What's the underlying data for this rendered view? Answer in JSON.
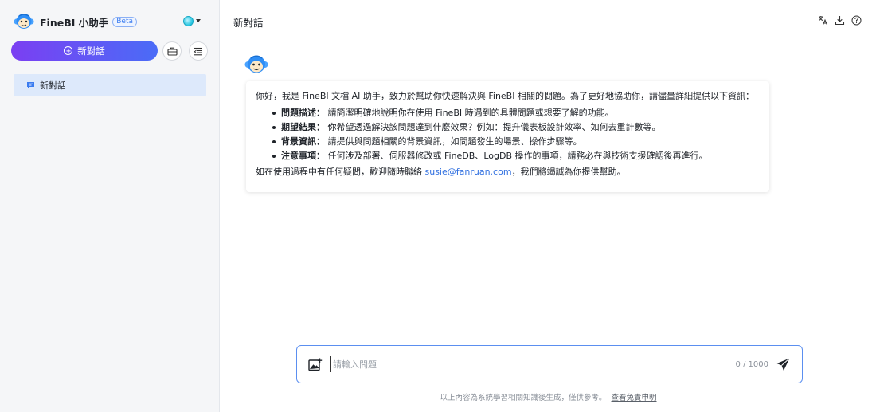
{
  "sidebar": {
    "brand_name": "FineBI 小助手",
    "beta_badge": "Beta",
    "new_chat_label": "新對話",
    "sessions": [
      {
        "label": "新對話",
        "icon": "chat-bubble-icon"
      }
    ]
  },
  "header": {
    "title": "新對話",
    "actions": [
      "translate-icon",
      "download-icon",
      "help-icon"
    ]
  },
  "message": {
    "intro": "你好，我是 FineBI 文檔 AI 助手，致力於幫助你快速解決與 FineBI 相關的問題。為了更好地協助你，請儘量詳細提供以下資訊：",
    "items": [
      {
        "term": "問題描述：",
        "text": "請簡潔明確地說明你在使用 FineBI 時遇到的具體問題或想要了解的功能。"
      },
      {
        "term": "期望結果：",
        "text": "你希望透過解決該問題達到什麼效果？例如：提升儀表板設計效率、如何去重計數等。"
      },
      {
        "term": "背景資訊：",
        "text": "請提供與問題相關的背景資訊，如問題發生的場景、操作步驟等。"
      },
      {
        "term": "注意事項：",
        "text": "任何涉及部署、伺服器修改或 FineDB、LogDB 操作的事項，請務必在與技術支援確認後再進行。"
      }
    ],
    "outro_before": "如在使用過程中有任何疑問，歡迎隨時聯絡 ",
    "email": "susie@fanruan.com",
    "outro_after": "，我們將竭誠為你提供幫助。"
  },
  "composer": {
    "placeholder": "請輸入問題",
    "value": "",
    "counter": "0 / 1000"
  },
  "footer": {
    "disclaimer": "以上內容為系統學習相關知識後生成，僅供參考。",
    "link_label": "查看免責申明"
  },
  "colors": {
    "accent_start": "#7b3ff2",
    "accent_end": "#4a6cf7",
    "session_active_bg": "#dde9fb",
    "link": "#2f6fe0",
    "input_border": "#5b8ff0"
  }
}
